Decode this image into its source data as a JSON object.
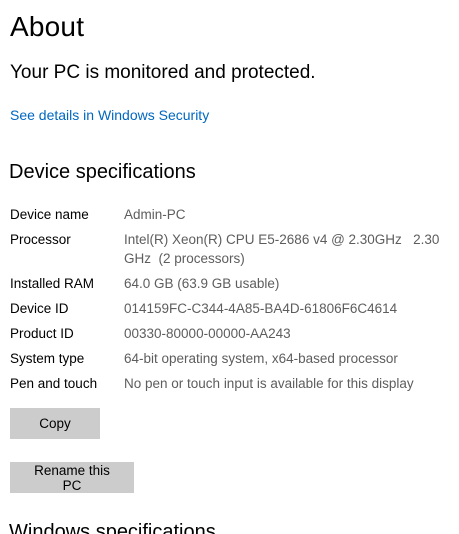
{
  "page": {
    "title": "About",
    "status": "Your PC is monitored and protected.",
    "security_link": "See details in Windows Security"
  },
  "device_specs": {
    "heading": "Device specifications",
    "rows": [
      {
        "label": "Device name",
        "value": "Admin-PC"
      },
      {
        "label": "Processor",
        "value": "Intel(R) Xeon(R) CPU E5-2686 v4 @ 2.30GHz   2.30 GHz  (2 processors)"
      },
      {
        "label": "Installed RAM",
        "value": "64.0 GB (63.9 GB usable)"
      },
      {
        "label": "Device ID",
        "value": "014159FC-C344-4A85-BA4D-61806F6C4614"
      },
      {
        "label": "Product ID",
        "value": "00330-80000-00000-AA243"
      },
      {
        "label": "System type",
        "value": "64-bit operating system, x64-based processor"
      },
      {
        "label": "Pen and touch",
        "value": "No pen or touch input is available for this display"
      }
    ],
    "copy_label": "Copy",
    "rename_label": "Rename this PC"
  },
  "windows_specs": {
    "heading": "Windows specifications"
  },
  "colors": {
    "link": "#0067c0",
    "button_bg": "#cccccc",
    "value_text": "#5d5d5d"
  }
}
